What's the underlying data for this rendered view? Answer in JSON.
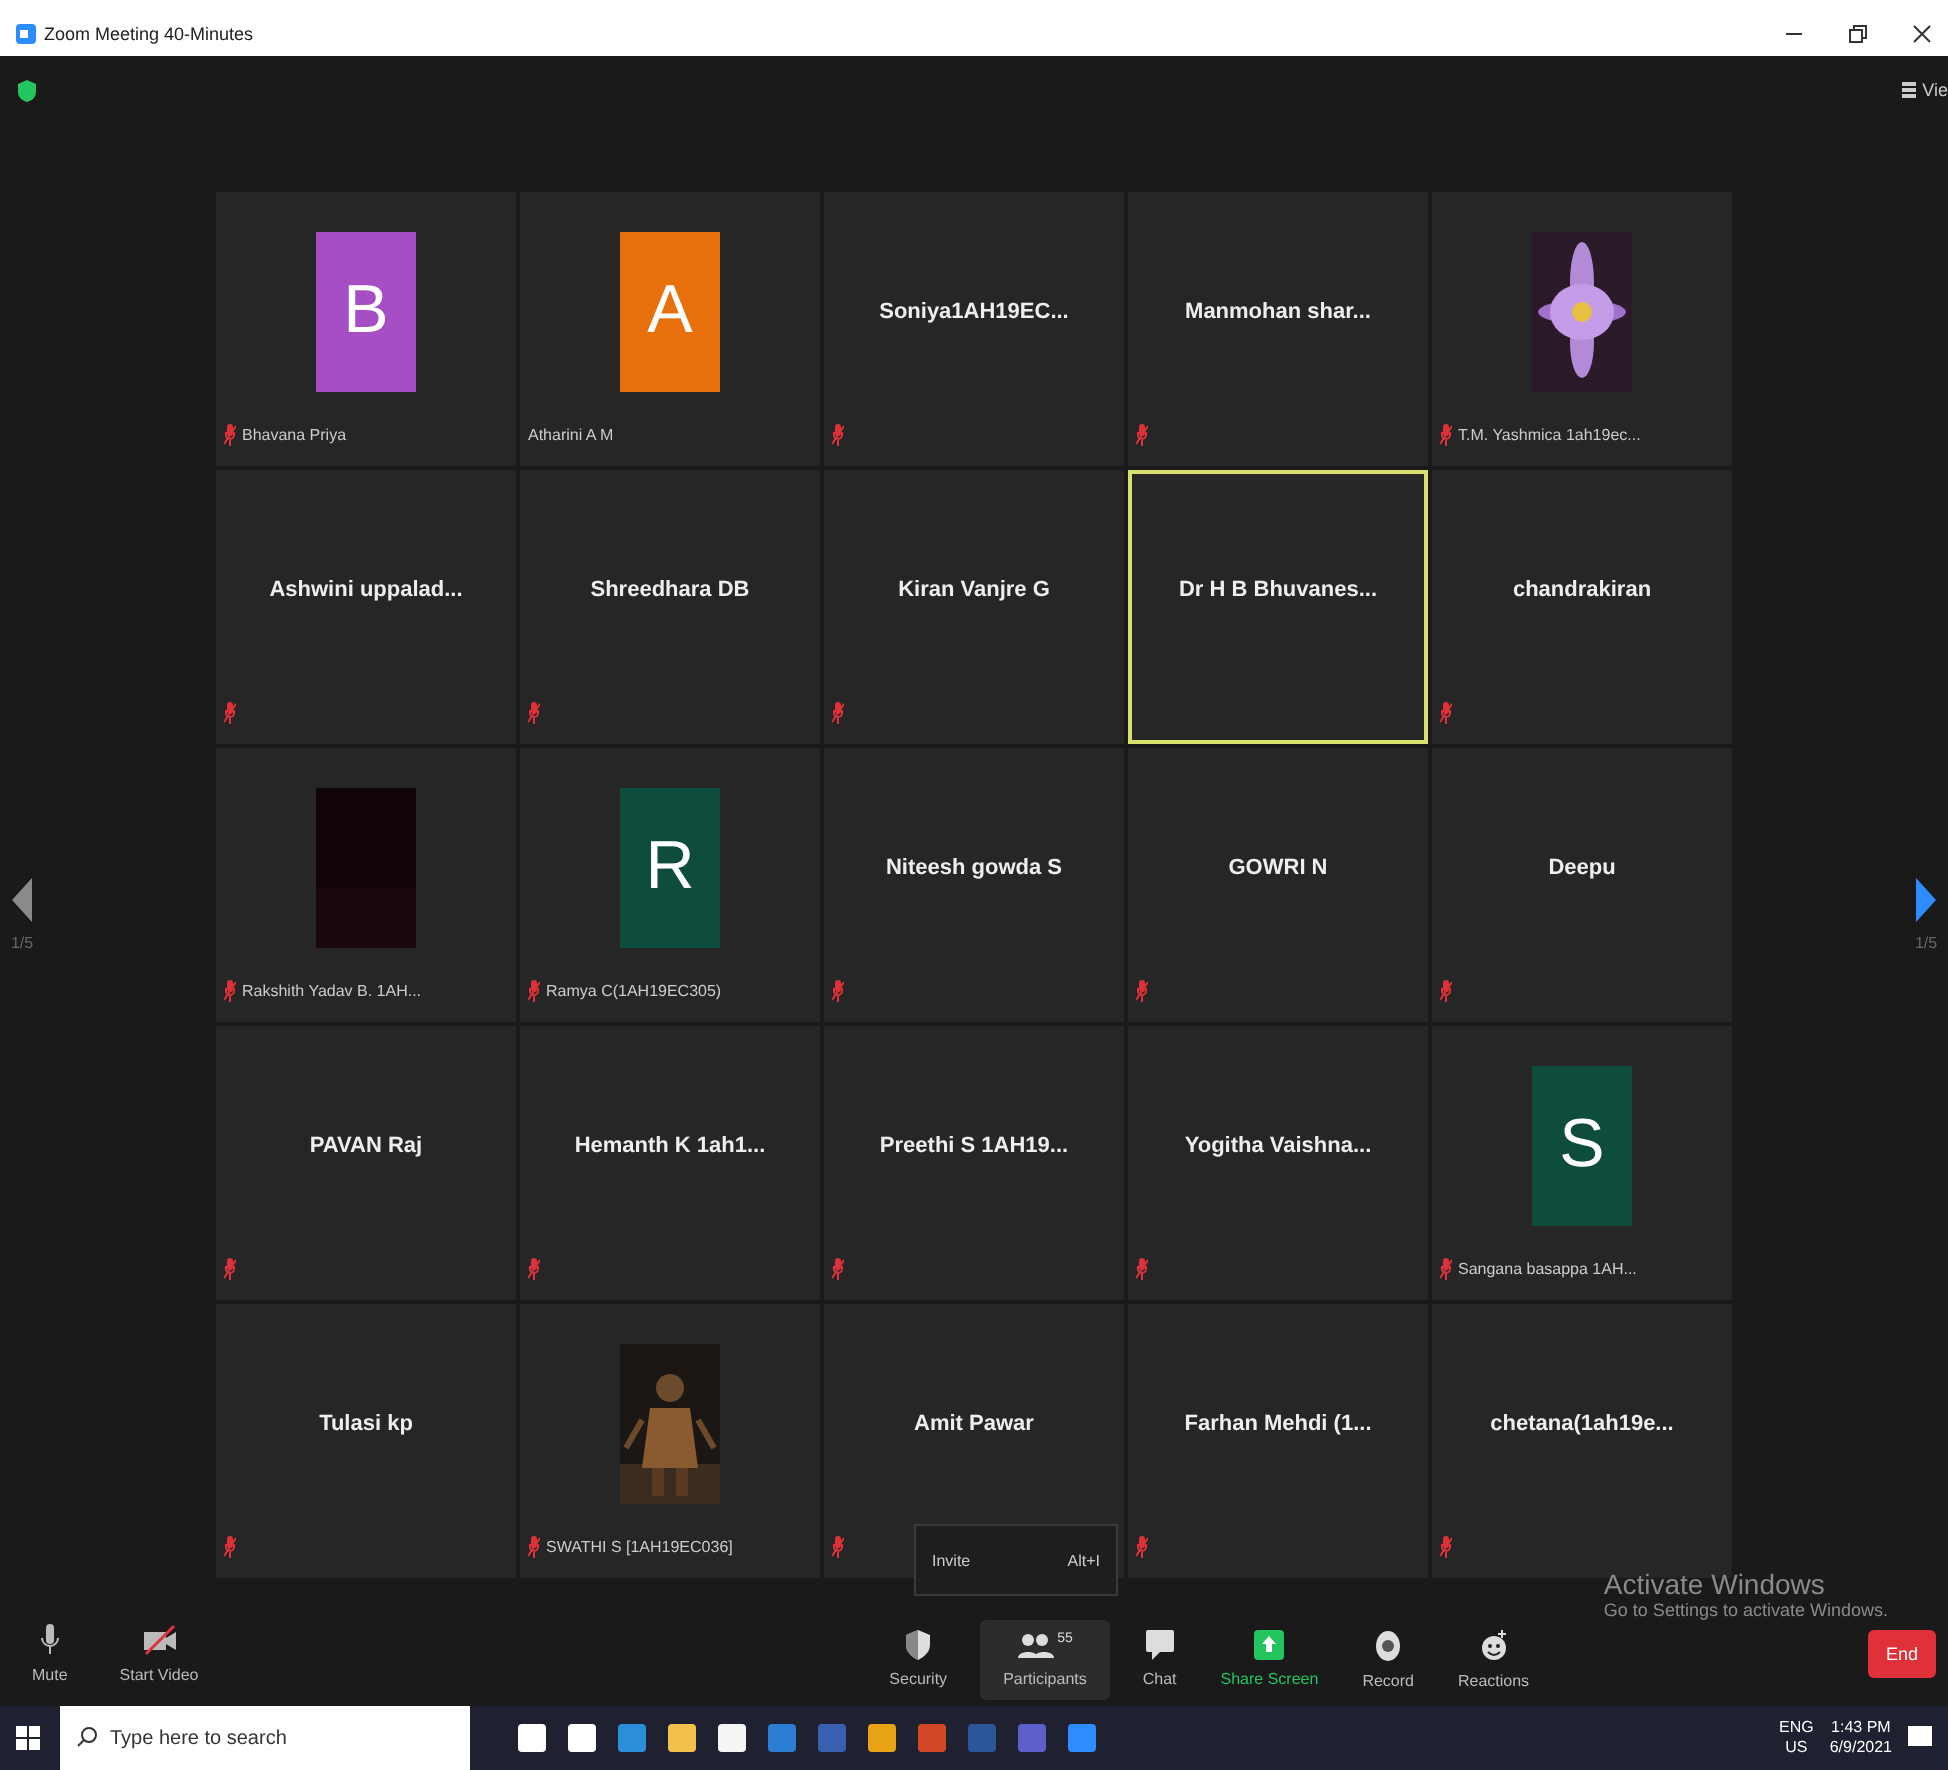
{
  "window": {
    "title": "Zoom Meeting 40-Minutes",
    "view_label": "Vie"
  },
  "pager": {
    "left": "1/5",
    "right": "1/5"
  },
  "tiles": [
    {
      "kind": "avatar",
      "letter": "B",
      "color": "#a64fc4",
      "label": "Bhavana Priya",
      "muted": true,
      "highlighted": false
    },
    {
      "kind": "avatar",
      "letter": "A",
      "color": "#e8700c",
      "label": "Atharini A M",
      "muted": false,
      "highlighted": false
    },
    {
      "kind": "name",
      "name": "Soniya1AH19EC...",
      "muted": true,
      "highlighted": false
    },
    {
      "kind": "name",
      "name": "Manmohan shar...",
      "muted": true,
      "highlighted": false
    },
    {
      "kind": "picture",
      "label": "T.M. Yashmica 1ah19ec...",
      "muted": true,
      "highlighted": false
    },
    {
      "kind": "name",
      "name": "Ashwini uppalad...",
      "muted": true,
      "highlighted": false
    },
    {
      "kind": "name",
      "name": "Shreedhara DB",
      "muted": true,
      "highlighted": false
    },
    {
      "kind": "name",
      "name": "Kiran Vanjre G",
      "muted": true,
      "highlighted": false
    },
    {
      "kind": "name",
      "name": "Dr H B Bhuvanes...",
      "muted": false,
      "highlighted": true
    },
    {
      "kind": "name",
      "name": "chandrakiran",
      "muted": true,
      "highlighted": false
    },
    {
      "kind": "picture",
      "label": "Rakshith Yadav B. 1AH...",
      "muted": true,
      "highlighted": false
    },
    {
      "kind": "avatar",
      "letter": "R",
      "color": "#0e4d3e",
      "label": "Ramya C(1AH19EC305)",
      "muted": true,
      "highlighted": false
    },
    {
      "kind": "name",
      "name": "Niteesh gowda S",
      "muted": true,
      "highlighted": false
    },
    {
      "kind": "name",
      "name": "GOWRI N",
      "muted": true,
      "highlighted": false
    },
    {
      "kind": "name",
      "name": "Deepu",
      "muted": true,
      "highlighted": false
    },
    {
      "kind": "name",
      "name": "PAVAN Raj",
      "muted": true,
      "highlighted": false
    },
    {
      "kind": "name",
      "name": "Hemanth K 1ah1...",
      "muted": true,
      "highlighted": false
    },
    {
      "kind": "name",
      "name": "Preethi S 1AH19...",
      "muted": true,
      "highlighted": false
    },
    {
      "kind": "name",
      "name": "Yogitha Vaishna...",
      "muted": true,
      "highlighted": false
    },
    {
      "kind": "avatar",
      "letter": "S",
      "color": "#0e4d3e",
      "label": "Sangana basappa 1AH...",
      "muted": true,
      "highlighted": false
    },
    {
      "kind": "name",
      "name": "Tulasi kp",
      "muted": true,
      "highlighted": false
    },
    {
      "kind": "picture",
      "label": "SWATHI S [1AH19EC036]",
      "muted": true,
      "highlighted": false
    },
    {
      "kind": "name",
      "name": "Amit Pawar",
      "muted": true,
      "highlighted": false
    },
    {
      "kind": "name",
      "name": "Farhan Mehdi (1...",
      "muted": true,
      "highlighted": false
    },
    {
      "kind": "name",
      "name": "chetana(1ah19e...",
      "muted": true,
      "highlighted": false
    }
  ],
  "tooltip": {
    "label": "Invite",
    "shortcut": "Alt+I"
  },
  "activation": {
    "title": "Activate Windows",
    "subtitle": "Go to Settings to activate Windows."
  },
  "toolbar": {
    "left": [
      {
        "kind": "mic",
        "label": "Mute"
      },
      {
        "kind": "video",
        "label": "Start Video"
      }
    ],
    "center": [
      {
        "kind": "security",
        "label": "Security"
      },
      {
        "kind": "participants",
        "label": "Participants",
        "count": "55"
      },
      {
        "kind": "chat",
        "label": "Chat"
      },
      {
        "kind": "share",
        "label": "Share Screen"
      },
      {
        "kind": "record",
        "label": "Record"
      },
      {
        "kind": "reactions",
        "label": "Reactions"
      }
    ],
    "end": "End"
  },
  "taskbar": {
    "search_placeholder": "Type here to search",
    "language": "ENG",
    "region": "US",
    "time": "1:43 PM",
    "date": "6/9/2021"
  }
}
